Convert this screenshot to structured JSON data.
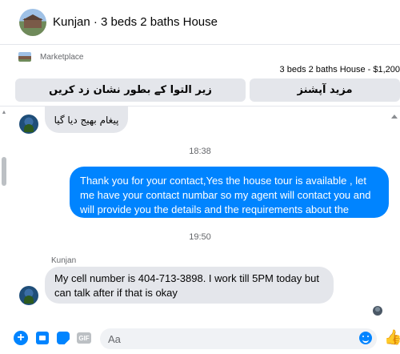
{
  "header": {
    "title": "Kunjan · 3 beds 2 baths House"
  },
  "marketplace": {
    "label": "Marketplace",
    "listing": "3 beds 2 baths House - $1,200",
    "buttons": [
      {
        "label": "زیر التوا کے بطور نشان زد کریں"
      },
      {
        "label": "مزید آپشنز"
      }
    ]
  },
  "conversation": {
    "messages": [
      {
        "direction": "incoming",
        "text": "پیغام بھیج دیا گیا"
      },
      {
        "type": "timestamp",
        "text": "18:38"
      },
      {
        "direction": "outgoing",
        "text": "Thank you for your contact,Yes the house tour is available , let me have your contact numbar so my agent will contact you and will provide you the details and the requirements about the house!!"
      },
      {
        "type": "timestamp",
        "text": "19:50"
      },
      {
        "direction": "incoming",
        "sender": "Kunjan",
        "text": "My cell number is 404-713-3898. I work till 5PM today but can talk after if that is okay"
      }
    ]
  },
  "composer": {
    "placeholder": "Aa",
    "gif_label": "GIF",
    "icons": [
      "plus-icon",
      "photo-icon",
      "sticker-icon",
      "gif-icon",
      "emoji-icon",
      "like-icon"
    ],
    "accent_color": "#0084ff"
  },
  "colors": {
    "outgoing_bubble": "#0084ff",
    "incoming_bubble": "#e4e6eb",
    "button_bg": "#e4e6eb"
  }
}
